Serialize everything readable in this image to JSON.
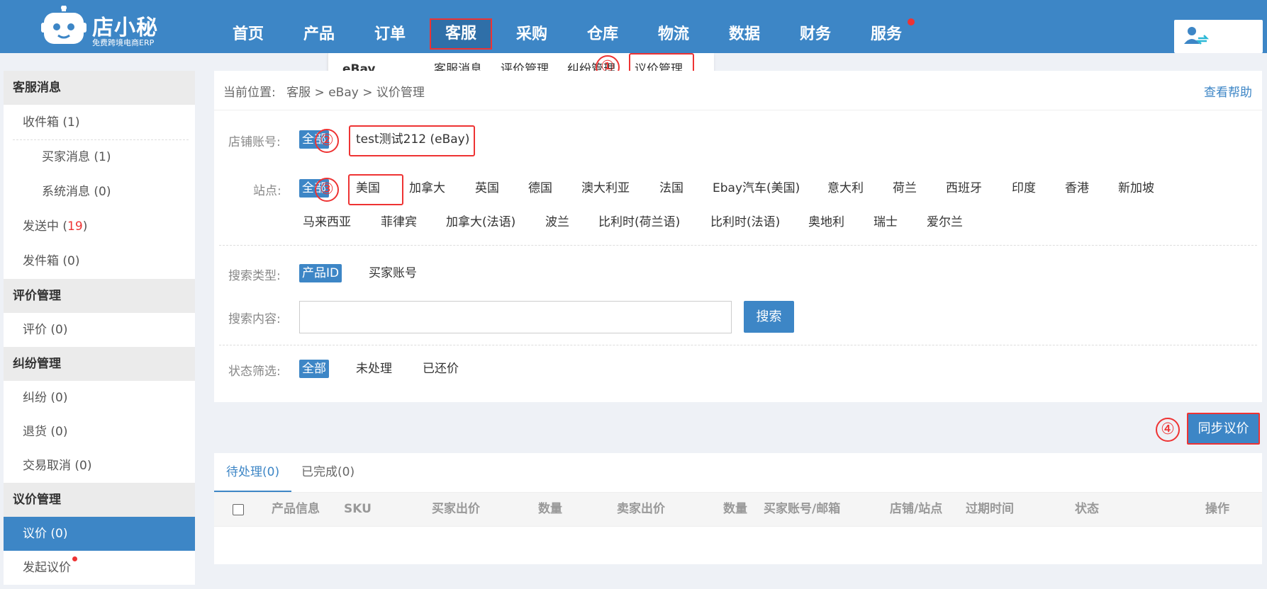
{
  "logo": {
    "title": "店小秘",
    "subtitle": "免费跨境电商ERP"
  },
  "nav": {
    "items": [
      "首页",
      "产品",
      "订单",
      "客服",
      "采购",
      "仓库",
      "物流",
      "数据",
      "财务",
      "服务"
    ],
    "active": "客服"
  },
  "submenu": {
    "platform": "eBay",
    "items": [
      "客服消息",
      "评价管理",
      "纠纷管理",
      "议价管理"
    ]
  },
  "annotations": {
    "n1": "①",
    "n2": "②",
    "n3": "③",
    "n4": "④"
  },
  "sidebar": {
    "sections": [
      {
        "title": "客服消息"
      },
      {
        "title": "评价管理"
      },
      {
        "title": "纠纷管理"
      },
      {
        "title": "议价管理"
      }
    ],
    "items": {
      "inbox": "收件箱 (1)",
      "buyer_msg": "买家消息 (1)",
      "system_msg": "系统消息 (0)",
      "sending_label": "发送中 (",
      "sending_count": "19",
      "sending_end": ")",
      "outbox": "发件箱 (0)",
      "review": "评价 (0)",
      "dispute": "纠纷 (0)",
      "return": "退货 (0)",
      "cancel": "交易取消 (0)",
      "offer": "议价 (0)",
      "start_offer": "发起议价"
    }
  },
  "breadcrumb": {
    "prefix": "当前位置:",
    "parts": [
      "客服",
      "eBay",
      "议价管理"
    ],
    "separator": ">"
  },
  "help_link": "查看帮助",
  "filters": {
    "store_label": "店铺账号:",
    "store_all": "全部",
    "store_option": "test测试212 (eBay)",
    "site_label": "站点:",
    "site_all": "全部",
    "sites_row1": [
      "美国",
      "加拿大",
      "英国",
      "德国",
      "澳大利亚",
      "法国",
      "Ebay汽车(美国)",
      "意大利",
      "荷兰",
      "西班牙",
      "印度",
      "香港",
      "新加坡"
    ],
    "sites_row2": [
      "马来西亚",
      "菲律宾",
      "加拿大(法语)",
      "波兰",
      "比利时(荷兰语)",
      "比利时(法语)",
      "奥地利",
      "瑞士",
      "爱尔兰"
    ],
    "search_type_label": "搜索类型:",
    "search_type_selected": "产品ID",
    "search_type_other": "买家账号",
    "search_content_label": "搜索内容:",
    "search_input_value": "",
    "search_button": "搜索",
    "status_label": "状态筛选:",
    "status_all": "全部",
    "status_unprocessed": "未处理",
    "status_countered": "已还价"
  },
  "sync_button": "同步议价",
  "tabs": [
    "待处理(0)",
    "已完成(0)"
  ],
  "table": {
    "headers": [
      "产品信息",
      "SKU",
      "买家出价",
      "数量",
      "卖家出价",
      "数量",
      "买家账号/邮箱",
      "店铺/站点",
      "过期时间",
      "状态",
      "操作"
    ]
  },
  "colors": {
    "primary": "#3d86c6",
    "annotation": "#e33333"
  }
}
